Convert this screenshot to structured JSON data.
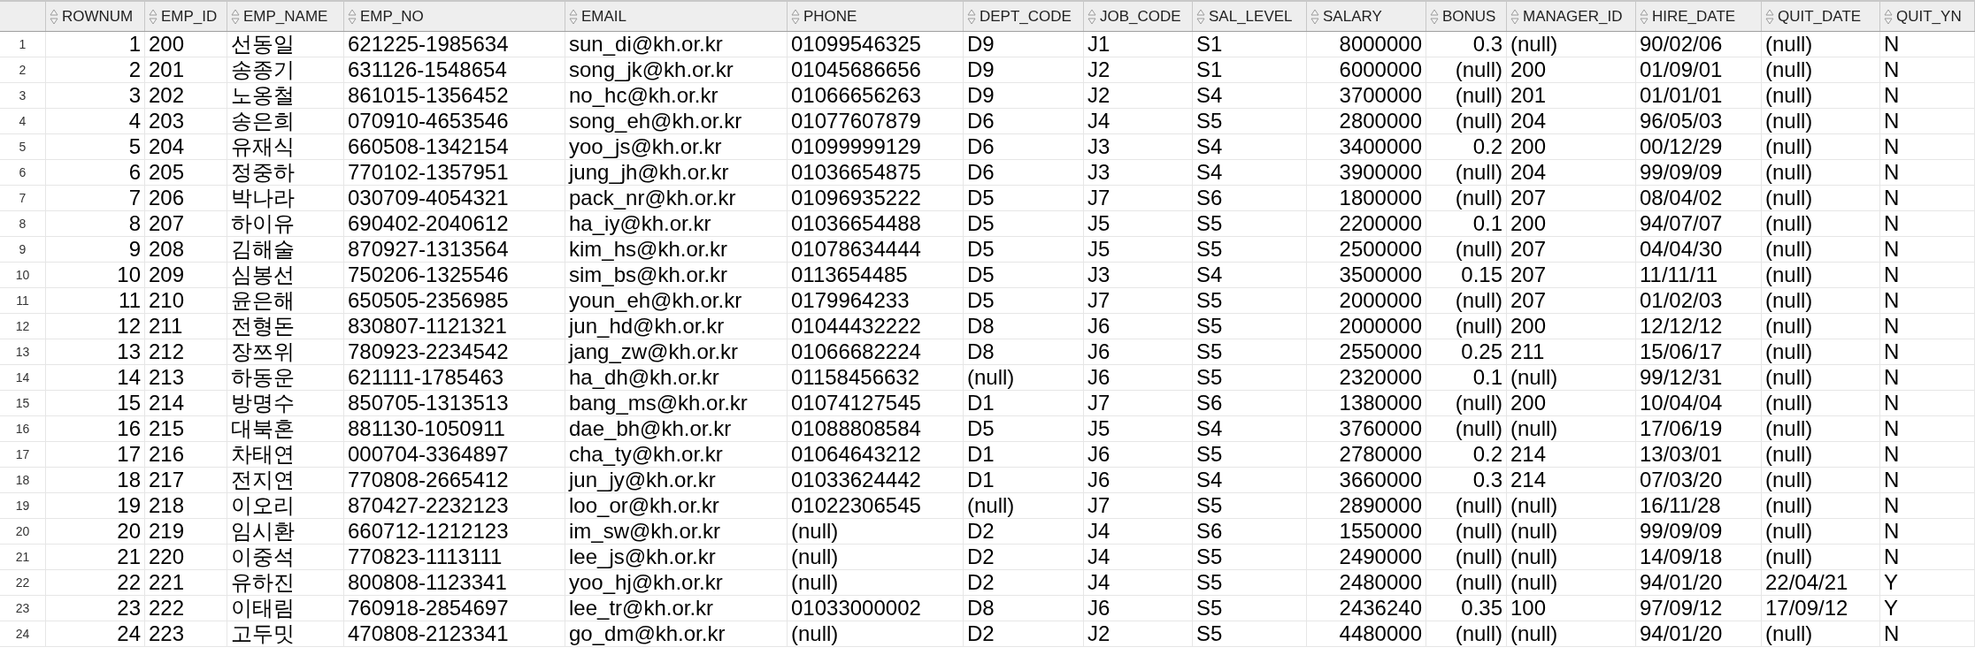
{
  "grid": {
    "columns": [
      {
        "label": "ROWNUM"
      },
      {
        "label": "EMP_ID"
      },
      {
        "label": "EMP_NAME"
      },
      {
        "label": "EMP_NO"
      },
      {
        "label": "EMAIL"
      },
      {
        "label": "PHONE"
      },
      {
        "label": "DEPT_CODE"
      },
      {
        "label": "JOB_CODE"
      },
      {
        "label": "SAL_LEVEL"
      },
      {
        "label": "SALARY"
      },
      {
        "label": "BONUS"
      },
      {
        "label": "MANAGER_ID"
      },
      {
        "label": "HIRE_DATE"
      },
      {
        "label": "QUIT_DATE"
      },
      {
        "label": "QUIT_YN"
      }
    ],
    "rows": [
      {
        "number": "1",
        "cells": [
          "1",
          "200",
          "선동일",
          "621225-1985634",
          "sun_di@kh.or.kr",
          "01099546325",
          "D9",
          "J1",
          "S1",
          "8000000",
          "0.3",
          "(null)",
          "90/02/06",
          "(null)",
          "N"
        ]
      },
      {
        "number": "2",
        "cells": [
          "2",
          "201",
          "송종기",
          "631126-1548654",
          "song_jk@kh.or.kr",
          "01045686656",
          "D9",
          "J2",
          "S1",
          "6000000",
          "(null)",
          "200",
          "01/09/01",
          "(null)",
          "N"
        ]
      },
      {
        "number": "3",
        "cells": [
          "3",
          "202",
          "노옹철",
          "861015-1356452",
          "no_hc@kh.or.kr",
          "01066656263",
          "D9",
          "J2",
          "S4",
          "3700000",
          "(null)",
          "201",
          "01/01/01",
          "(null)",
          "N"
        ]
      },
      {
        "number": "4",
        "cells": [
          "4",
          "203",
          "송은희",
          "070910-4653546",
          "song_eh@kh.or.kr",
          "01077607879",
          "D6",
          "J4",
          "S5",
          "2800000",
          "(null)",
          "204",
          "96/05/03",
          "(null)",
          "N"
        ]
      },
      {
        "number": "5",
        "cells": [
          "5",
          "204",
          "유재식",
          "660508-1342154",
          "yoo_js@kh.or.kr",
          "01099999129",
          "D6",
          "J3",
          "S4",
          "3400000",
          "0.2",
          "200",
          "00/12/29",
          "(null)",
          "N"
        ]
      },
      {
        "number": "6",
        "cells": [
          "6",
          "205",
          "정중하",
          "770102-1357951",
          "jung_jh@kh.or.kr",
          "01036654875",
          "D6",
          "J3",
          "S4",
          "3900000",
          "(null)",
          "204",
          "99/09/09",
          "(null)",
          "N"
        ]
      },
      {
        "number": "7",
        "cells": [
          "7",
          "206",
          "박나라",
          "030709-4054321",
          "pack_nr@kh.or.kr",
          "01096935222",
          "D5",
          "J7",
          "S6",
          "1800000",
          "(null)",
          "207",
          "08/04/02",
          "(null)",
          "N"
        ]
      },
      {
        "number": "8",
        "cells": [
          "8",
          "207",
          "하이유",
          "690402-2040612",
          "ha_iy@kh.or.kr",
          "01036654488",
          "D5",
          "J5",
          "S5",
          "2200000",
          "0.1",
          "200",
          "94/07/07",
          "(null)",
          "N"
        ]
      },
      {
        "number": "9",
        "cells": [
          "9",
          "208",
          "김해술",
          "870927-1313564",
          "kim_hs@kh.or.kr",
          "01078634444",
          "D5",
          "J5",
          "S5",
          "2500000",
          "(null)",
          "207",
          "04/04/30",
          "(null)",
          "N"
        ]
      },
      {
        "number": "10",
        "cells": [
          "10",
          "209",
          "심봉선",
          "750206-1325546",
          "sim_bs@kh.or.kr",
          "0113654485",
          "D5",
          "J3",
          "S4",
          "3500000",
          "0.15",
          "207",
          "11/11/11",
          "(null)",
          "N"
        ]
      },
      {
        "number": "11",
        "cells": [
          "11",
          "210",
          "윤은해",
          "650505-2356985",
          "youn_eh@kh.or.kr",
          "0179964233",
          "D5",
          "J7",
          "S5",
          "2000000",
          "(null)",
          "207",
          "01/02/03",
          "(null)",
          "N"
        ]
      },
      {
        "number": "12",
        "cells": [
          "12",
          "211",
          "전형돈",
          "830807-1121321",
          "jun_hd@kh.or.kr",
          "01044432222",
          "D8",
          "J6",
          "S5",
          "2000000",
          "(null)",
          "200",
          "12/12/12",
          "(null)",
          "N"
        ]
      },
      {
        "number": "13",
        "cells": [
          "13",
          "212",
          "장쯔위",
          "780923-2234542",
          "jang_zw@kh.or.kr",
          "01066682224",
          "D8",
          "J6",
          "S5",
          "2550000",
          "0.25",
          "211",
          "15/06/17",
          "(null)",
          "N"
        ]
      },
      {
        "number": "14",
        "cells": [
          "14",
          "213",
          "하동운",
          "621111-1785463",
          "ha_dh@kh.or.kr",
          "01158456632",
          "(null)",
          "J6",
          "S5",
          "2320000",
          "0.1",
          "(null)",
          "99/12/31",
          "(null)",
          "N"
        ]
      },
      {
        "number": "15",
        "cells": [
          "15",
          "214",
          "방명수",
          "850705-1313513",
          "bang_ms@kh.or.kr",
          "01074127545",
          "D1",
          "J7",
          "S6",
          "1380000",
          "(null)",
          "200",
          "10/04/04",
          "(null)",
          "N"
        ]
      },
      {
        "number": "16",
        "cells": [
          "16",
          "215",
          "대북혼",
          "881130-1050911",
          "dae_bh@kh.or.kr",
          "01088808584",
          "D5",
          "J5",
          "S4",
          "3760000",
          "(null)",
          "(null)",
          "17/06/19",
          "(null)",
          "N"
        ]
      },
      {
        "number": "17",
        "cells": [
          "17",
          "216",
          "차태연",
          "000704-3364897",
          "cha_ty@kh.or.kr",
          "01064643212",
          "D1",
          "J6",
          "S5",
          "2780000",
          "0.2",
          "214",
          "13/03/01",
          "(null)",
          "N"
        ]
      },
      {
        "number": "18",
        "cells": [
          "18",
          "217",
          "전지연",
          "770808-2665412",
          "jun_jy@kh.or.kr",
          "01033624442",
          "D1",
          "J6",
          "S4",
          "3660000",
          "0.3",
          "214",
          "07/03/20",
          "(null)",
          "N"
        ]
      },
      {
        "number": "19",
        "cells": [
          "19",
          "218",
          "이오리",
          "870427-2232123",
          "loo_or@kh.or.kr",
          "01022306545",
          "(null)",
          "J7",
          "S5",
          "2890000",
          "(null)",
          "(null)",
          "16/11/28",
          "(null)",
          "N"
        ]
      },
      {
        "number": "20",
        "cells": [
          "20",
          "219",
          "임시환",
          "660712-1212123",
          "im_sw@kh.or.kr",
          "(null)",
          "D2",
          "J4",
          "S6",
          "1550000",
          "(null)",
          "(null)",
          "99/09/09",
          "(null)",
          "N"
        ]
      },
      {
        "number": "21",
        "cells": [
          "21",
          "220",
          "이중석",
          "770823-1113111",
          "lee_js@kh.or.kr",
          "(null)",
          "D2",
          "J4",
          "S5",
          "2490000",
          "(null)",
          "(null)",
          "14/09/18",
          "(null)",
          "N"
        ]
      },
      {
        "number": "22",
        "cells": [
          "22",
          "221",
          "유하진",
          "800808-1123341",
          "yoo_hj@kh.or.kr",
          "(null)",
          "D2",
          "J4",
          "S5",
          "2480000",
          "(null)",
          "(null)",
          "94/01/20",
          "22/04/21",
          "Y"
        ]
      },
      {
        "number": "23",
        "cells": [
          "23",
          "222",
          "이태림",
          "760918-2854697",
          "lee_tr@kh.or.kr",
          "01033000002",
          "D8",
          "J6",
          "S5",
          "2436240",
          "0.35",
          "100",
          "97/09/12",
          "17/09/12",
          "Y"
        ]
      },
      {
        "number": "24",
        "cells": [
          "24",
          "223",
          "고두밋",
          "470808-2123341",
          "go_dm@kh.or.kr",
          "(null)",
          "D2",
          "J2",
          "S5",
          "4480000",
          "(null)",
          "(null)",
          "94/01/20",
          "(null)",
          "N"
        ]
      }
    ]
  }
}
